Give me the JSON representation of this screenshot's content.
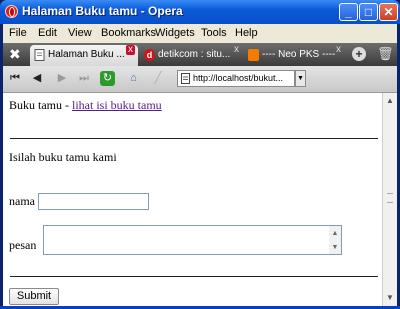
{
  "window": {
    "title": "Halaman Buku tamu - Opera"
  },
  "menu": [
    "File",
    "Edit",
    "View",
    "Bookmarks",
    "Widgets",
    "Tools",
    "Help"
  ],
  "tabs": [
    {
      "label": "Halaman Buku ...",
      "active": true
    },
    {
      "label": "detikcom : situ...",
      "active": false
    },
    {
      "label": "---- Neo PKS ----",
      "active": false
    }
  ],
  "address": {
    "url": "http://localhost/bukut..."
  },
  "page": {
    "header_text": "Buku tamu - ",
    "header_link": "lihat isi buku tamu",
    "intro": "Isilah buku tamu kami",
    "nama_label": "nama",
    "nama_value": "",
    "pesan_label": "pesan",
    "pesan_value": "",
    "submit_label": "Submit"
  },
  "colors": {
    "titlebar": "#0b5bd8",
    "link": "#551a8b",
    "tabbar": "#3a3a3a"
  }
}
